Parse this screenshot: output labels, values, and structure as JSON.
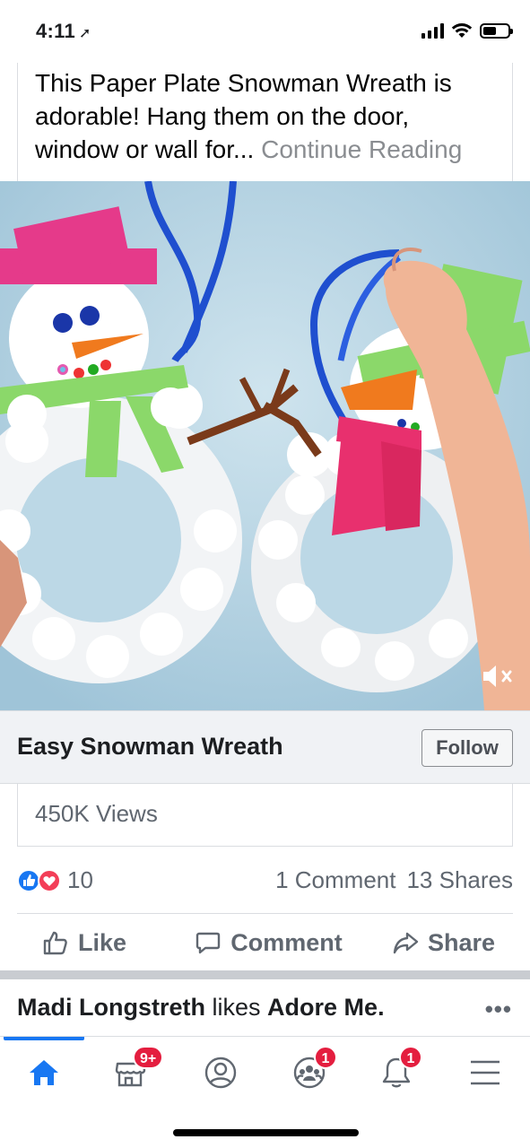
{
  "status_bar": {
    "time": "4:11",
    "location_glyph": "➚"
  },
  "post": {
    "text": "This Paper Plate Snowman Wreath is adorable!  Hang them on the door, window or wall for...",
    "continue_label": "Continue Reading"
  },
  "video": {
    "subject": "paper plate snowman wreaths",
    "muted": true
  },
  "link": {
    "title": "Easy Snowman Wreath",
    "follow_label": "Follow"
  },
  "views": "450K Views",
  "reactions": {
    "count": "10",
    "comments": "1 Comment",
    "shares": "13 Shares",
    "types": [
      "like",
      "love"
    ]
  },
  "actions": {
    "like": "Like",
    "comment": "Comment",
    "share": "Share"
  },
  "story": {
    "actor": "Madi Longstreth",
    "verb": "likes",
    "page": "Adore Me.",
    "more": "•••"
  },
  "tab_bar": {
    "tabs": [
      {
        "name": "home",
        "icon": "home-icon",
        "active": true,
        "badge": ""
      },
      {
        "name": "marketplace",
        "icon": "marketplace-icon",
        "active": false,
        "badge": "9+"
      },
      {
        "name": "profile",
        "icon": "profile-icon",
        "active": false,
        "badge": ""
      },
      {
        "name": "groups",
        "icon": "groups-icon",
        "active": false,
        "badge": "1"
      },
      {
        "name": "notifications",
        "icon": "bell-icon",
        "active": false,
        "badge": "1"
      },
      {
        "name": "menu",
        "icon": "menu-icon",
        "active": false,
        "badge": ""
      }
    ]
  },
  "colors": {
    "brand": "#1877f2",
    "badge": "#e41e3f",
    "secondary_text": "#606770"
  }
}
